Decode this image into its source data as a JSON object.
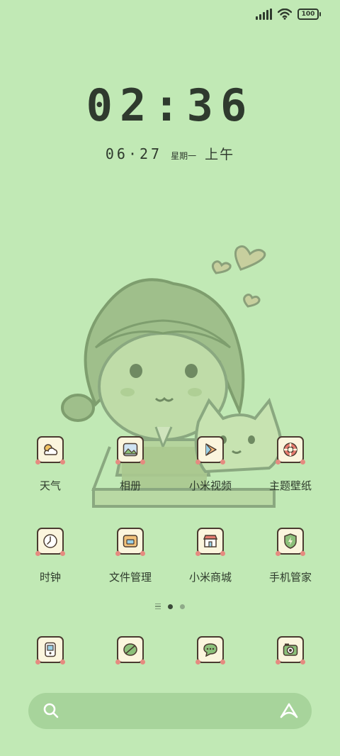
{
  "status_bar": {
    "battery": "100"
  },
  "clock": {
    "time": "02:36"
  },
  "date": {
    "date": "06·27",
    "weekday": "星期一",
    "ampm": "上午"
  },
  "apps_row1": [
    {
      "label": "天气",
      "icon": "weather-icon"
    },
    {
      "label": "相册",
      "icon": "gallery-icon"
    },
    {
      "label": "小米视频",
      "icon": "video-icon"
    },
    {
      "label": "主题壁纸",
      "icon": "themes-icon"
    }
  ],
  "apps_row2": [
    {
      "label": "时钟",
      "icon": "clock-icon"
    },
    {
      "label": "文件管理",
      "icon": "file-manager-icon"
    },
    {
      "label": "小米商城",
      "icon": "mi-store-icon"
    },
    {
      "label": "手机管家",
      "icon": "security-icon"
    }
  ],
  "dock": [
    {
      "icon": "phone-icon"
    },
    {
      "icon": "browser-icon"
    },
    {
      "icon": "messages-icon"
    },
    {
      "icon": "camera-icon"
    }
  ],
  "page_indicator": {
    "pages": 2,
    "current": 1
  },
  "colors": {
    "background": "#c1e9b5",
    "search_bar": "#a7d49b",
    "icon_fill": "#fbf5dd",
    "icon_border": "#4a3b30",
    "text": "#2e3b2c"
  }
}
